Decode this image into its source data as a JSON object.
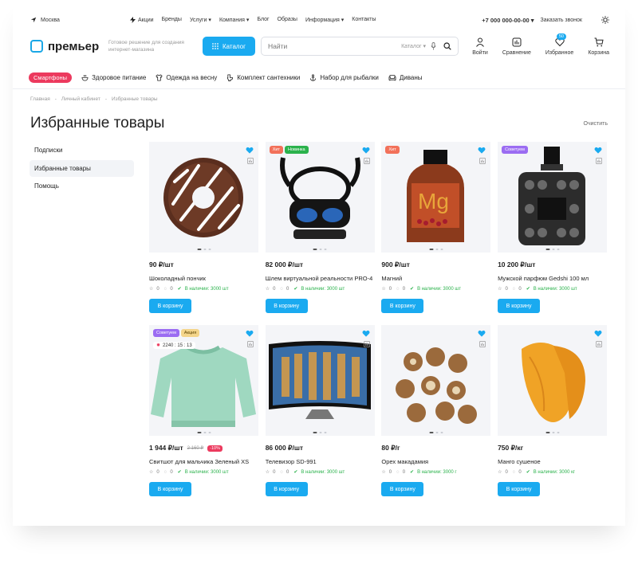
{
  "topbar": {
    "city": "Москва",
    "nav": [
      "Акции",
      "Бренды",
      "Услуги ▾",
      "Компания ▾",
      "Блог",
      "Образы",
      "Информация ▾",
      "Контакты"
    ],
    "phone": "+7 000 000-00-00 ▾",
    "callback": "Заказать звонок"
  },
  "header": {
    "logo": "премьер",
    "tagline": "Готовое решение для создания интернет-магазина",
    "catalog_label": "Каталог",
    "search_placeholder": "Найти",
    "search_scope": "Каталог ▾",
    "icons": [
      {
        "label": "Войти",
        "icon": "user-icon"
      },
      {
        "label": "Сравнение",
        "icon": "compare-icon"
      },
      {
        "label": "Избранное",
        "icon": "heart-icon",
        "badge": "50"
      },
      {
        "label": "Корзина",
        "icon": "cart-icon"
      }
    ]
  },
  "quicklinks": [
    "Смартфоны",
    "Здоровое питание",
    "Одежда на весну",
    "Комплект сантехники",
    "Набор для рыбалки",
    "Диваны"
  ],
  "breadcrumbs": [
    "Главная",
    "-",
    "Личный кабинет",
    "-",
    "Избранные товары"
  ],
  "page_title": "Избранные товары",
  "clear_label": "Очистить",
  "sidebar": [
    {
      "label": "Подписки",
      "active": false
    },
    {
      "label": "Избранные товары",
      "active": true
    },
    {
      "label": "Помощь",
      "active": false
    }
  ],
  "buy_label": "В корзину",
  "stock_prefix": "В наличии:",
  "products": [
    {
      "price": "90 ₽/шт",
      "name": "Шоколадный пончик",
      "rating": "0",
      "reviews": "0",
      "stock": "3000 шт",
      "badges": [],
      "image": "donut"
    },
    {
      "price": "82 000 ₽/шт",
      "name": "Шлем виртуальной реальности PRO-4",
      "rating": "0",
      "reviews": "0",
      "stock": "3000 шт",
      "badges": [
        {
          "text": "Хит",
          "color": "#f2715a"
        },
        {
          "text": "Новинка",
          "color": "#2bb24c"
        }
      ],
      "image": "vr"
    },
    {
      "price": "900 ₽/шт",
      "name": "Магний",
      "rating": "0",
      "reviews": "0",
      "stock": "3000 шт",
      "badges": [
        {
          "text": "Хит",
          "color": "#f2715a"
        }
      ],
      "image": "bottle"
    },
    {
      "price": "10 200 ₽/шт",
      "name": "Мужской парфюм Gedshi 100 мл",
      "rating": "0",
      "reviews": "0",
      "stock": "3000 шт",
      "badges": [
        {
          "text": "Советуем",
          "color": "#9b6cf2"
        }
      ],
      "image": "perfume"
    },
    {
      "price": "1 944 ₽/шт",
      "old_price": "2 160 ₽",
      "discount": "-10%",
      "name": "Свитшот для мальчика Зеленый XS",
      "rating": "0",
      "reviews": "0",
      "stock": "3000 шт",
      "badges": [
        {
          "text": "Советуем",
          "color": "#9b6cf2"
        },
        {
          "text": "Акция",
          "color": "#f4d58a",
          "textColor": "#5a4200"
        }
      ],
      "timer": "2240 : 15 : 13",
      "image": "sweater"
    },
    {
      "price": "86 000 ₽/шт",
      "name": "Телевизор SD-991",
      "rating": "0",
      "reviews": "0",
      "stock": "3000 шт",
      "badges": [],
      "image": "tv"
    },
    {
      "price": "80 ₽/г",
      "name": "Орех макадамия",
      "rating": "0",
      "reviews": "0",
      "stock": "3000 г",
      "badges": [],
      "image": "nuts"
    },
    {
      "price": "750 ₽/кг",
      "name": "Манго сушеное",
      "rating": "0",
      "reviews": "0",
      "stock": "3000 кг",
      "badges": [],
      "image": "mango"
    }
  ],
  "colors": {
    "accent": "#1aaaf0",
    "hot": "#ec3a5e",
    "in_stock": "#2bb24c"
  }
}
